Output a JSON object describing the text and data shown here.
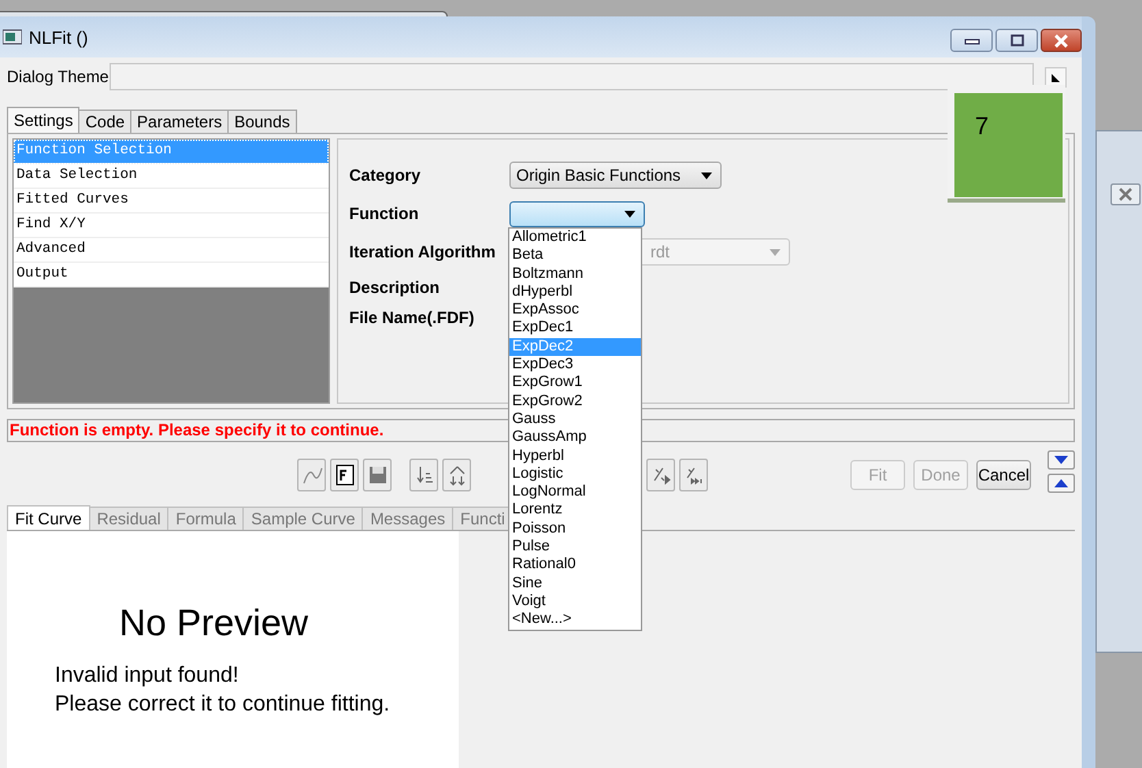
{
  "window": {
    "title": "NLFit ()"
  },
  "dialog_theme": {
    "label": "Dialog Theme"
  },
  "badge": {
    "label": "7"
  },
  "tabs": [
    {
      "label": "Settings",
      "selected": true
    },
    {
      "label": "Code",
      "selected": false
    },
    {
      "label": "Parameters",
      "selected": false
    },
    {
      "label": "Bounds",
      "selected": false
    }
  ],
  "tree": {
    "items": [
      {
        "label": "Function Selection",
        "selected": true
      },
      {
        "label": "Data Selection",
        "selected": false
      },
      {
        "label": "Fitted Curves",
        "selected": false
      },
      {
        "label": "Find X/Y",
        "selected": false
      },
      {
        "label": "Advanced",
        "selected": false
      },
      {
        "label": "Output",
        "selected": false
      }
    ]
  },
  "category": {
    "label": "Category",
    "value": "Origin Basic Functions"
  },
  "function": {
    "label": "Function",
    "expanded": true,
    "options": [
      {
        "label": "Allometric1",
        "selected": false
      },
      {
        "label": "Beta",
        "selected": false
      },
      {
        "label": "Boltzmann",
        "selected": false
      },
      {
        "label": "dHyperbl",
        "selected": false
      },
      {
        "label": "ExpAssoc",
        "selected": false
      },
      {
        "label": "ExpDec1",
        "selected": false
      },
      {
        "label": "ExpDec2",
        "selected": true
      },
      {
        "label": "ExpDec3",
        "selected": false
      },
      {
        "label": "ExpGrow1",
        "selected": false
      },
      {
        "label": "ExpGrow2",
        "selected": false
      },
      {
        "label": "Gauss",
        "selected": false
      },
      {
        "label": "GaussAmp",
        "selected": false
      },
      {
        "label": "Hyperbl",
        "selected": false
      },
      {
        "label": "Logistic",
        "selected": false
      },
      {
        "label": "LogNormal",
        "selected": false
      },
      {
        "label": "Lorentz",
        "selected": false
      },
      {
        "label": "Poisson",
        "selected": false
      },
      {
        "label": "Pulse",
        "selected": false
      },
      {
        "label": "Rational0",
        "selected": false
      },
      {
        "label": "Sine",
        "selected": false
      },
      {
        "label": "Voigt",
        "selected": false
      },
      {
        "label": "<New...>",
        "selected": false
      }
    ]
  },
  "iteration_algorithm": {
    "label": "Iteration Algorithm",
    "value": "rdt",
    "disabled": true
  },
  "description": {
    "label": "Description"
  },
  "file_name": {
    "label": "File Name(.FDF)"
  },
  "status_message": "Function is empty. Please specify it to continue.",
  "action_buttons": [
    {
      "label": "Fit",
      "disabled": true
    },
    {
      "label": "Done",
      "disabled": true
    },
    {
      "label": "Cancel",
      "disabled": false
    }
  ],
  "bottom_tabs": [
    {
      "label": "Fit Curve",
      "selected": true
    },
    {
      "label": "Residual",
      "selected": false
    },
    {
      "label": "Formula",
      "selected": false
    },
    {
      "label": "Sample Curve",
      "selected": false
    },
    {
      "label": "Messages",
      "selected": false
    },
    {
      "label": "Functi",
      "selected": false
    }
  ],
  "preview": {
    "title": "No Preview",
    "lines": [
      "Invalid input found!",
      "Please correct it to continue fitting."
    ]
  }
}
